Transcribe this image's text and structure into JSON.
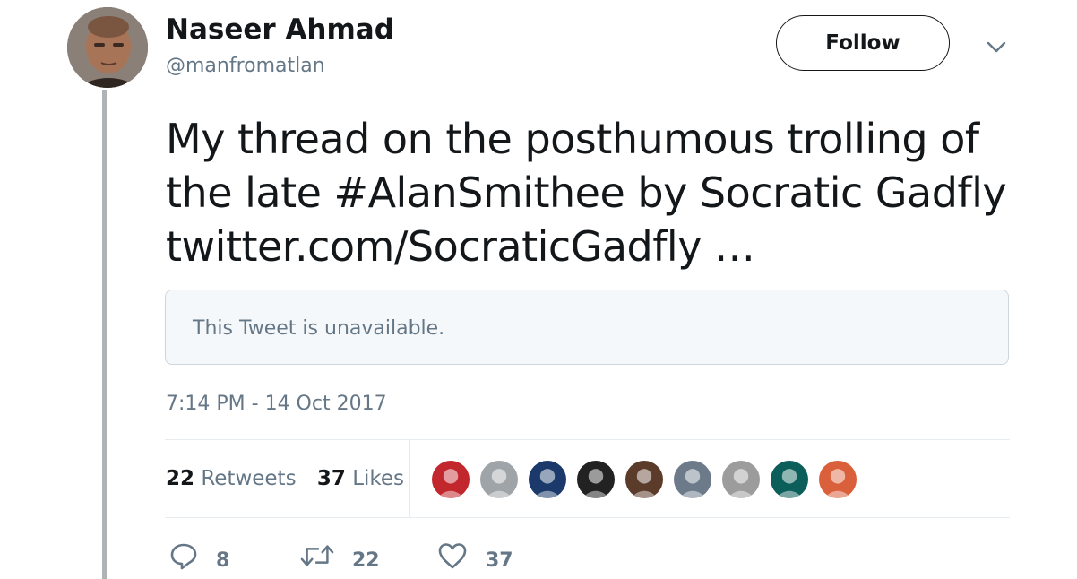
{
  "author": {
    "display_name": "Naseer Ahmad",
    "handle": "@manfromatlan"
  },
  "follow_label": "Follow",
  "tweet": {
    "text_lines": [
      "My thread on the posthumous trolling of",
      "the late #AlanSmithee by Socratic Gadfly",
      "twitter.com/SocraticGadfly …"
    ],
    "hashtag": "#AlanSmithee",
    "link": "twitter.com/SocraticGadfly …"
  },
  "quoted_tweet": {
    "message": "This Tweet is unavailable."
  },
  "timestamp": "7:14 PM - 14 Oct 2017",
  "stats": {
    "retweets": {
      "count": "22",
      "label": "Retweets"
    },
    "likes": {
      "count": "37",
      "label": "Likes"
    }
  },
  "liker_avatars": [
    {
      "name": "liker-avatar-1",
      "color": "#c1272d"
    },
    {
      "name": "liker-avatar-2",
      "color": "#9fa4a8"
    },
    {
      "name": "liker-avatar-3",
      "color": "#1b3a6b"
    },
    {
      "name": "liker-avatar-4",
      "color": "#222222"
    },
    {
      "name": "liker-avatar-5",
      "color": "#5b3b2a"
    },
    {
      "name": "liker-avatar-6",
      "color": "#6c7a8a"
    },
    {
      "name": "liker-avatar-7",
      "color": "#9c9c9c"
    },
    {
      "name": "liker-avatar-8",
      "color": "#0b5e5a"
    },
    {
      "name": "liker-avatar-9",
      "color": "#d9603b"
    }
  ],
  "actions": {
    "reply_count": "8",
    "retweet_count": "22",
    "like_count": "37"
  },
  "icons": {
    "caret": "chevron-down-icon",
    "reply": "reply-icon",
    "retweet": "retweet-icon",
    "like": "heart-icon"
  },
  "colors": {
    "text": "#14171a",
    "secondary": "#657786",
    "border": "#ccd6dd",
    "quote_bg": "#f5f8fa",
    "thread_line": "#b0b3b6"
  }
}
